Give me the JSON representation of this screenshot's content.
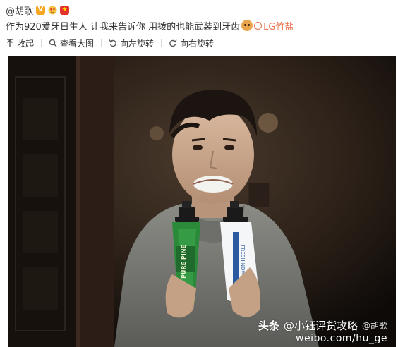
{
  "header": {
    "username": "@胡歌",
    "vip_badge": "V",
    "flag_badge": "★"
  },
  "post": {
    "text_before": "作为920爱牙日生人 让我来告诉你 用拨的也能武装到牙齿",
    "mention": "LG竹盐"
  },
  "toolbar": {
    "collapse": "收起",
    "view_large": "查看大图",
    "rotate_left": "向左旋转",
    "rotate_right": "向右旋转"
  },
  "photo": {
    "tube_left_label": "PURE PINE",
    "tube_right_label": "FRESH NOW"
  },
  "watermark": {
    "brand": "头条",
    "source": "@小钰评货攻略",
    "weibo_handle": "@胡歌",
    "url": "weibo.com/hu_ge"
  },
  "colors": {
    "link": "#eb7350",
    "text": "#333333"
  }
}
